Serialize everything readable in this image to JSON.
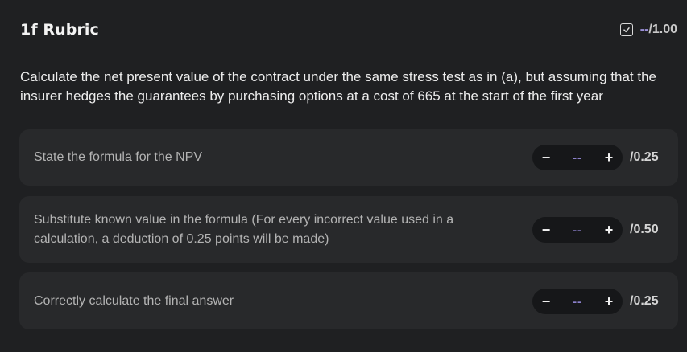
{
  "rubric": {
    "title": "1f Rubric",
    "score_value": "--",
    "score_total": "/1.00",
    "question": "Calculate the net present value of the contract under the same stress test as in (a), but assuming that the insurer hedges the guarantees by purchasing options at a cost of 665 at the start of the first year"
  },
  "criteria": [
    {
      "label": "State the formula for the NPV",
      "value": "--",
      "max": "/0.25",
      "minus": "−",
      "plus": "+"
    },
    {
      "label": "Substitute known value in the formula (For every incorrect value used in a calculation, a deduction of 0.25 points will be made)",
      "value": "--",
      "max": "/0.50",
      "minus": "−",
      "plus": "+"
    },
    {
      "label": "Correctly calculate the final answer",
      "value": "--",
      "max": "/0.25",
      "minus": "−",
      "plus": "+"
    }
  ],
  "icons": {
    "total_check": "checkbox-check-icon"
  },
  "colors": {
    "accent": "#9a8fd6",
    "background": "#1f2022",
    "card": "#28292b"
  }
}
